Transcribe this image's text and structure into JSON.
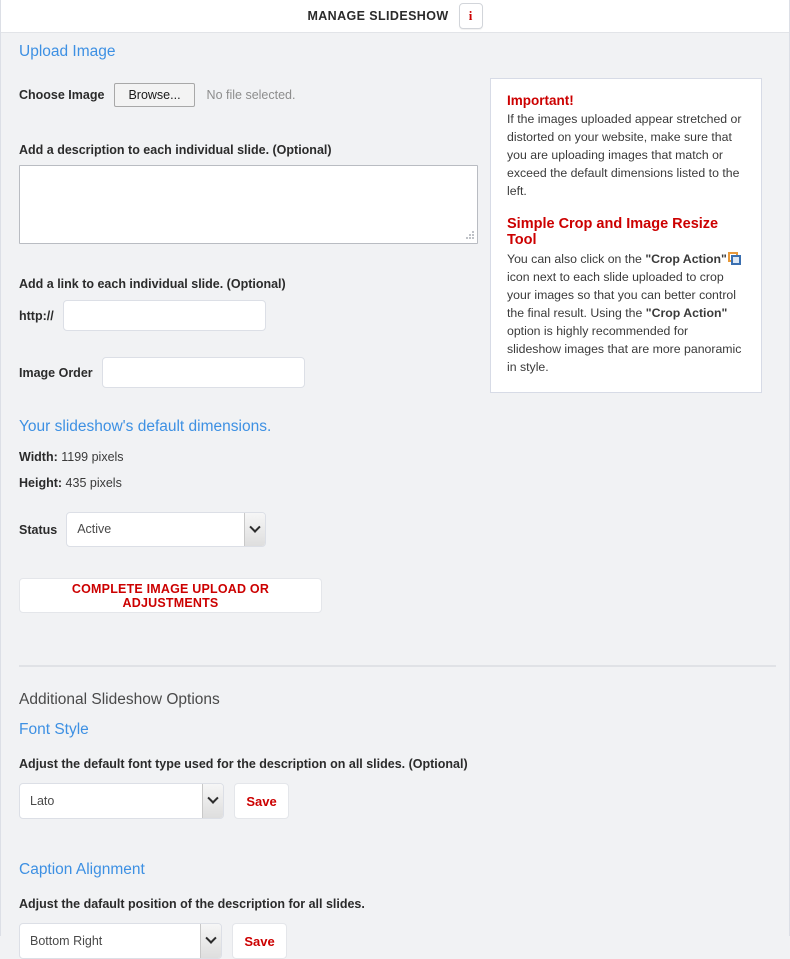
{
  "header": {
    "title": "MANAGE SLIDESHOW",
    "info_button_label": "i",
    "info_icon_name": "info-icon"
  },
  "upload": {
    "section_title": "Upload Image",
    "choose_image_label": "Choose Image",
    "browse_button_label": "Browse...",
    "no_file_text": "No file selected.",
    "description_label": "Add a description to each individual slide. (Optional)",
    "description_value": "",
    "link_label": "Add a link to each individual slide. (Optional)",
    "http_prefix": "http://",
    "http_value": "",
    "image_order_label": "Image Order",
    "image_order_value": "",
    "dimensions_title": "Your slideshow's default dimensions.",
    "width_label": "Width:",
    "width_value": "1199 pixels",
    "height_label": "Height:",
    "height_value": "435 pixels",
    "status_label": "Status",
    "status_value": "Active",
    "complete_button_label": "COMPLETE IMAGE UPLOAD OR ADJUSTMENTS"
  },
  "info_box": {
    "heading_1": "Important!",
    "body_1": "If the images uploaded appear stretched or distorted on your website, make sure that you are uploading images that match or exceed the default dimensions listed to the left.",
    "heading_2": "Simple Crop and Image Resize Tool",
    "body_2_part1": "You can also click on the",
    "body_2_bold1": "\"Crop Action\"",
    "body_2_part2": "icon next to each slide uploaded to crop your images so that you can better control the final result. Using the",
    "body_2_bold2": "\"Crop Action\"",
    "body_2_part3": "option is highly recommended for slideshow images that are more panoramic in style.",
    "crop_icon_name": "crop-action-icon"
  },
  "additional": {
    "section_title": "Additional Slideshow Options",
    "font_style_title": "Font Style",
    "font_style_label": "Adjust the default font type used for the description on all slides. (Optional)",
    "font_value": "Lato",
    "font_save_label": "Save",
    "caption_title": "Caption Alignment",
    "caption_label": "Adjust the dafault position of the description for all slides.",
    "caption_value": "Bottom Right",
    "caption_save_label": "Save"
  },
  "colors": {
    "accent_blue": "#3d90e3",
    "accent_red": "#cc0000",
    "page_bg": "#f1f2f4"
  }
}
